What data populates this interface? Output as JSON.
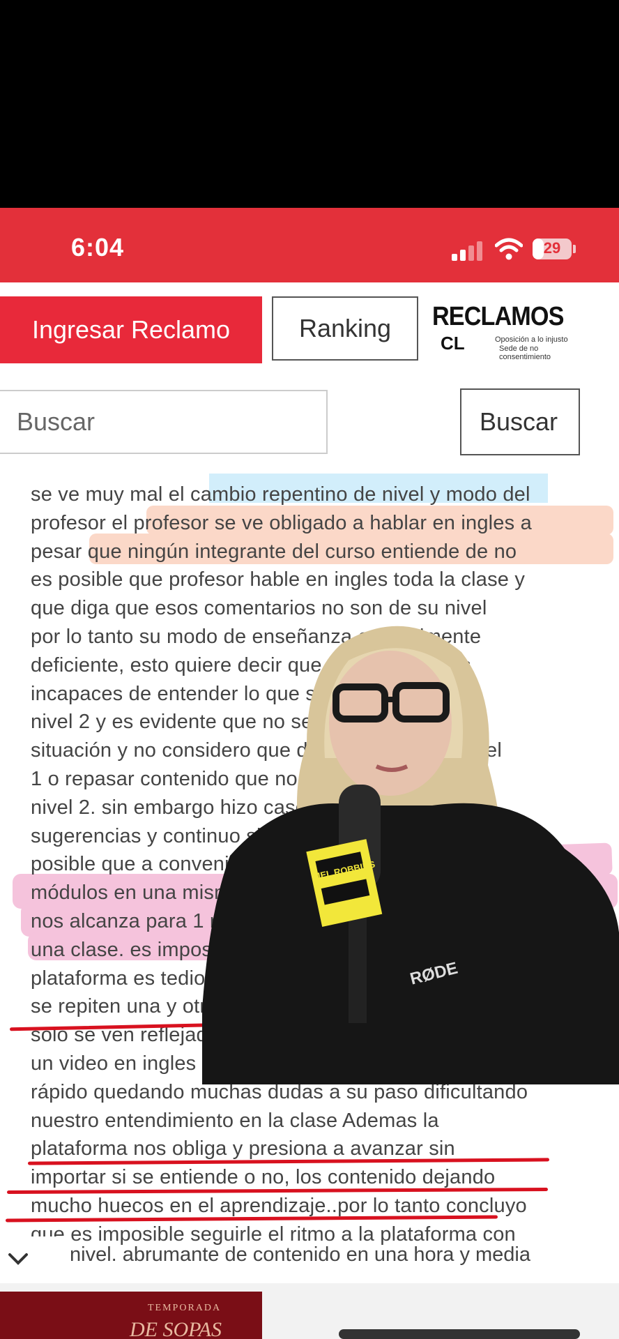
{
  "status_bar": {
    "time": "6:04",
    "battery_level": "29"
  },
  "nav": {
    "ingresar_label": "Ingresar Reclamo",
    "ranking_label": "Ranking",
    "logo": {
      "title": "RECLAMOS",
      "suffix": "CL",
      "tagline_1": "Oposición a lo injusto",
      "tagline_2": "Sede de no consentimiento"
    }
  },
  "search": {
    "placeholder": "Buscar",
    "button_label": "Buscar"
  },
  "overlay": {
    "mic_brand": "MEL ROBBINS",
    "mic_model": "RØDE"
  },
  "complaint": {
    "lines": [
      "se ve muy mal el cambio repentino de nivel y modo del",
      "profesor el profesor se ve obligado a hablar en ingles a",
      "pesar que ningún integrante del curso entiende de no",
      "es posible que profesor hable en ingles toda la clase y",
      "que diga que esos comentarios no son de su nivel",
      "por lo tanto su modo de enseñanza es totalmente",
      "deficiente, esto quiere decir que somos alumnos",
      "incapaces de entender lo que se explica en el",
      "nivel 2 y es evidente que no se esta enseñando la",
      "situación y no considero que debamos bajar al nivel",
      "1 o repasar contenido que no corresponde en el",
      "nivel 2. sin embargo hizo caso omiso a nuestras",
      "sugerencias y continuo sin detenerse.ademas no es",
      "posible que a conveniencia del profesor realice dos",
      "módulos en una misma clase ya que el tiempo apenas",
      "nos alcanza para 1 modulo y condensar 2 módulos en",
      "una clase. es imposible obtener buenos resultadola",
      "plataforma es tediosa e inflexible cosa muy sencillas",
      "se repiten una y otra vez y otros temas mas dificiles",
      "solo se ven reflejados en una explicación escueta en",
      "un video en ingles que no se entiende y se ve muy",
      "rápido quedando muchas dudas a su paso dificultando",
      "nuestro entendimiento en la clase Ademas la",
      "plataforma nos obliga y presiona a avanzar sin",
      "importar si se entiende o no, los contenido dejando",
      "mucho huecos en el aprendizaje..por lo tanto concluyo",
      "que es imposible seguirle el ritmo a la plataforma con"
    ],
    "last_line": "nivel. abrumante de contenido en una hora y media"
  },
  "promo": {
    "line1": "TEMPORADA",
    "line2": "DE SOPAS"
  },
  "colors": {
    "brand_red": "#e3303a",
    "button_red": "#e8293a",
    "underline": "#d8111f"
  }
}
